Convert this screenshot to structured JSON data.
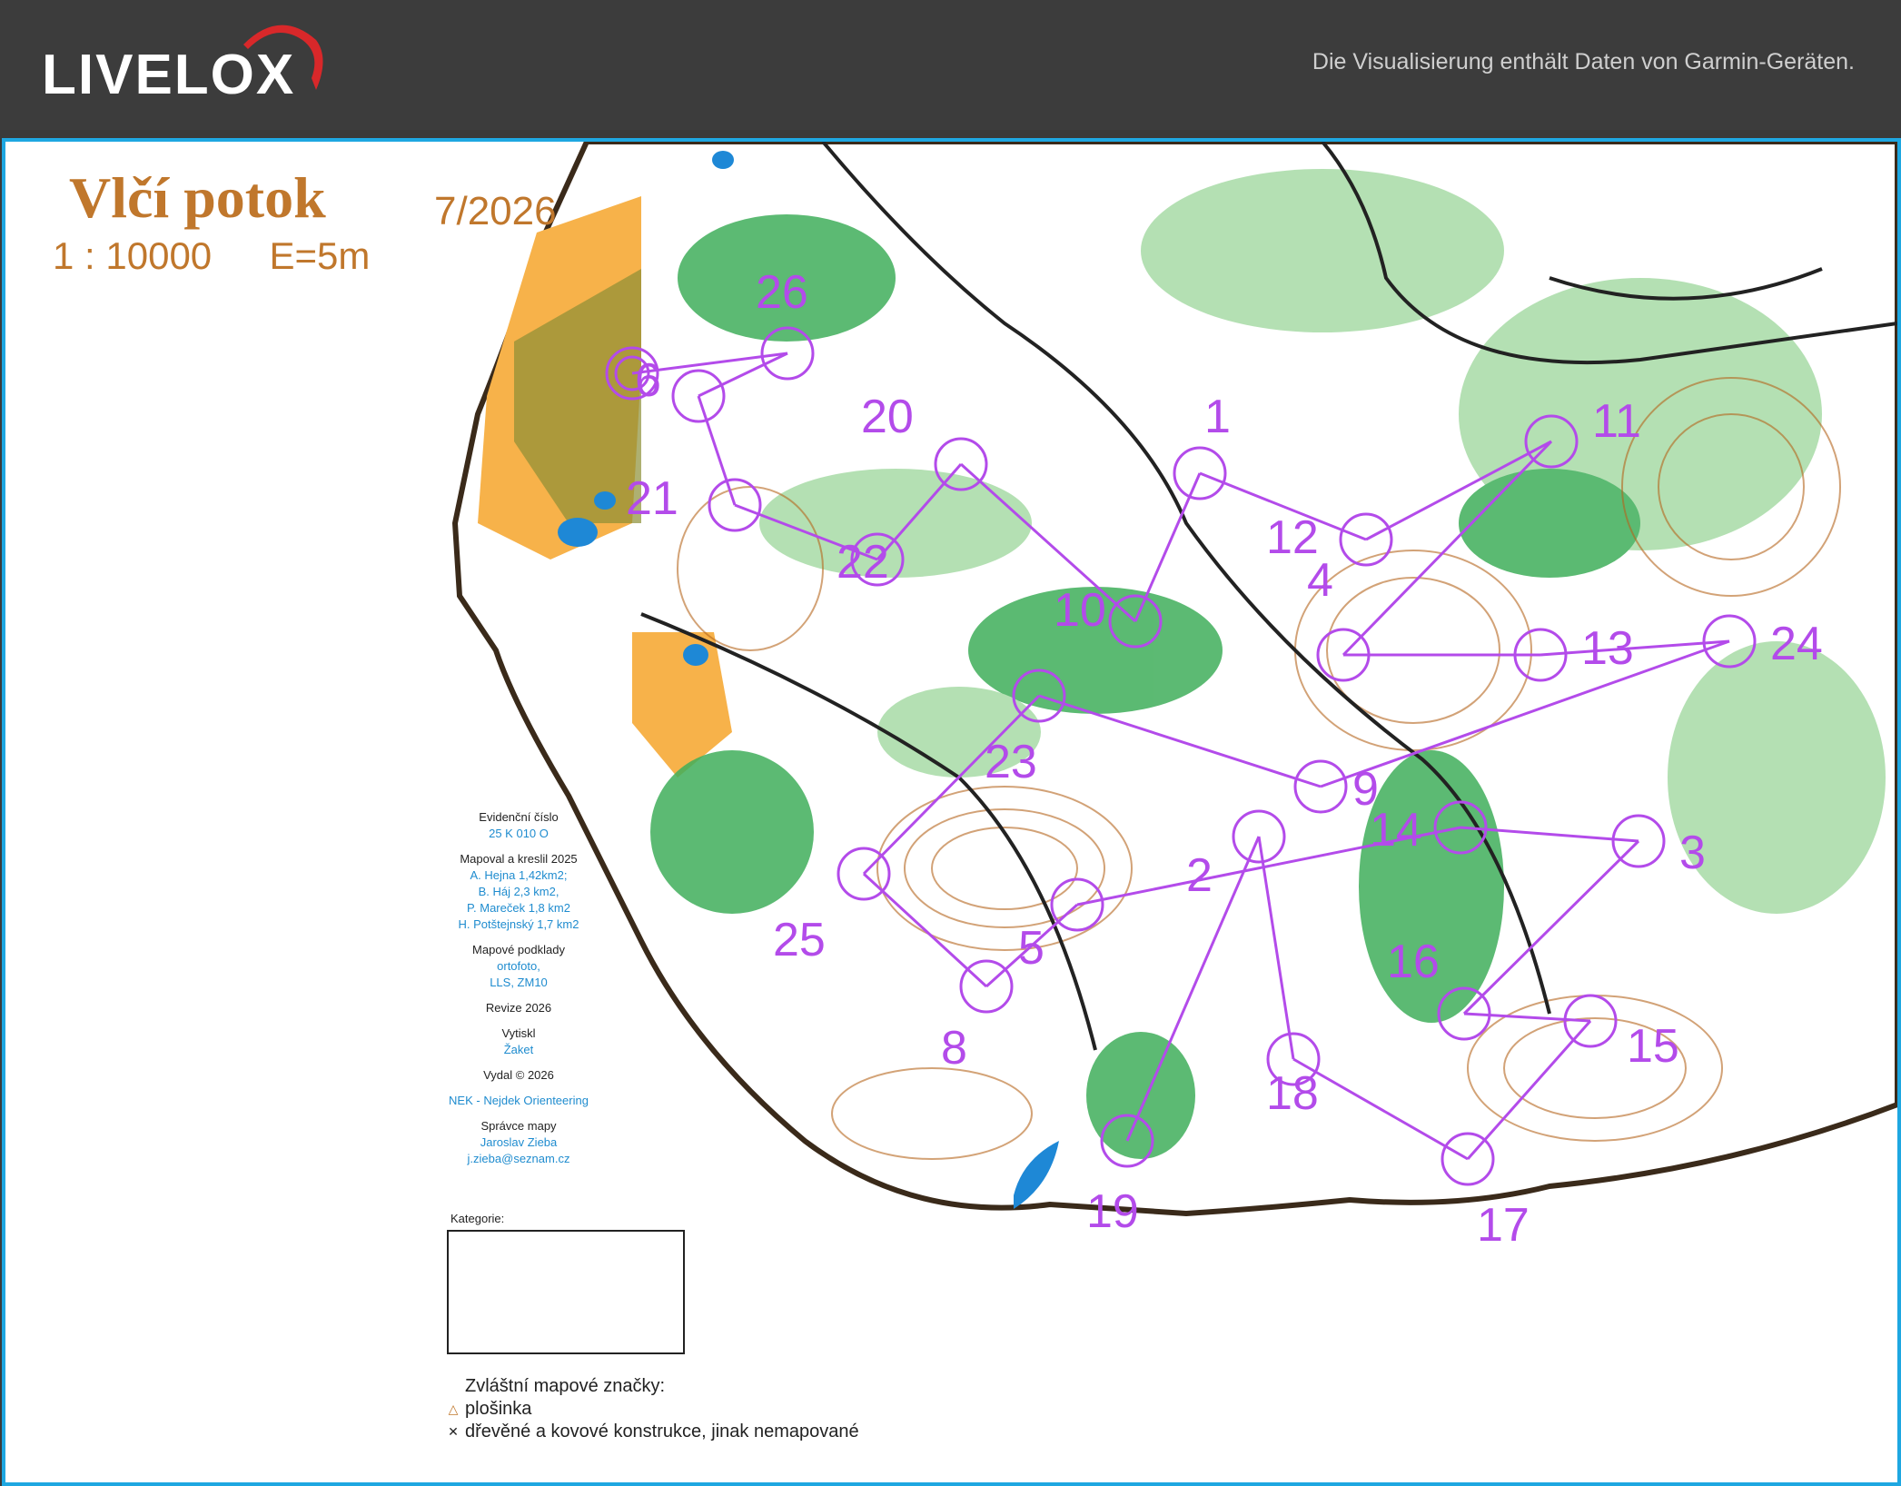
{
  "header": {
    "logo_text": "LIVELOX",
    "note": "Die Visualisierung enthält Daten von Garmin-Geräten."
  },
  "map": {
    "title": "Vlčí potok",
    "date": "7/2026",
    "scale": "1 : 10000",
    "contour_interval": "E=5m",
    "info": [
      {
        "key": "Evidenční číslo",
        "values": [
          "25 K 010 O"
        ]
      },
      {
        "key": "Mapoval a kreslil 2025",
        "values": [
          "A. Hejna 1,42km2;",
          "B. Háj 2,3 km2,",
          "P. Mareček 1,8 km2",
          "H. Potštejnský 1,7 km2"
        ]
      },
      {
        "key": "Mapové podklady",
        "values": [
          "ortofoto,",
          "LLS, ZM10"
        ]
      },
      {
        "key": "Revize 2026",
        "values": []
      },
      {
        "key": "Vytiskl",
        "values": [
          "Žaket"
        ]
      },
      {
        "key": "Vydal © 2026",
        "values": []
      },
      {
        "key": "",
        "values": [
          "NEK - Nejdek Orienteering"
        ]
      },
      {
        "key": "Správce mapy",
        "values": [
          "Jaroslav Zieba",
          "j.zieba@seznam.cz"
        ]
      }
    ],
    "category_label": "Kategorie:",
    "legend_title": "Zvláštní mapové značky:",
    "legend_items": [
      {
        "symbol": "triangle",
        "label": "plošinka"
      },
      {
        "symbol": "cross",
        "label": "dřevěné a kovové konstrukce, jinak nemapované"
      }
    ],
    "controls": [
      {
        "label": "1"
      },
      {
        "label": "2"
      },
      {
        "label": "3"
      },
      {
        "label": "4"
      },
      {
        "label": "5"
      },
      {
        "label": "6"
      },
      {
        "label": "8"
      },
      {
        "label": "9"
      },
      {
        "label": "10"
      },
      {
        "label": "11"
      },
      {
        "label": "12"
      },
      {
        "label": "13"
      },
      {
        "label": "14"
      },
      {
        "label": "15"
      },
      {
        "label": "16"
      },
      {
        "label": "17"
      },
      {
        "label": "18"
      },
      {
        "label": "19"
      },
      {
        "label": "20"
      },
      {
        "label": "21"
      },
      {
        "label": "22"
      },
      {
        "label": "23"
      },
      {
        "label": "24"
      },
      {
        "label": "25"
      },
      {
        "label": "26"
      }
    ],
    "colors": {
      "course": "#b34bea",
      "forest": "#3fae5a",
      "light_forest": "#a7dba6",
      "open": "#f7b24a",
      "contour": "#b5651d",
      "water": "#1e88d6",
      "frame": "#1ea7e1"
    }
  }
}
